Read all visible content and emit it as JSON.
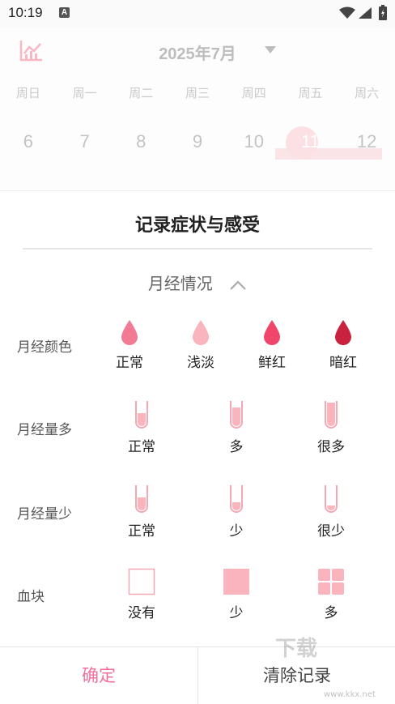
{
  "status_bar": {
    "time": "10:19",
    "a_icon": "A"
  },
  "calendar": {
    "month": "2025年7月",
    "weekdays": [
      "周日",
      "周一",
      "周二",
      "周三",
      "周四",
      "周五",
      "周六"
    ],
    "dates": [
      "6",
      "7",
      "8",
      "9",
      "10",
      "11",
      "12"
    ]
  },
  "sheet": {
    "title": "记录症状与感受",
    "section_title": "月经情况",
    "rows": {
      "color": {
        "label": "月经颜色",
        "options": [
          "正常",
          "浅淡",
          "鲜红",
          "暗红"
        ],
        "colors": [
          "#f27a95",
          "#f9b4bd",
          "#f0466a",
          "#c8223f"
        ]
      },
      "heavy": {
        "label": "月经量多",
        "options": [
          "正常",
          "多",
          "很多"
        ]
      },
      "light": {
        "label": "月经量少",
        "options": [
          "正常",
          "少",
          "很少"
        ]
      },
      "clot": {
        "label": "血块",
        "options": [
          "没有",
          "少",
          "多"
        ]
      }
    }
  },
  "buttons": {
    "confirm": "确定",
    "clear": "清除记录"
  },
  "watermark": {
    "text": "下载",
    "url": "www.kkx.net"
  }
}
